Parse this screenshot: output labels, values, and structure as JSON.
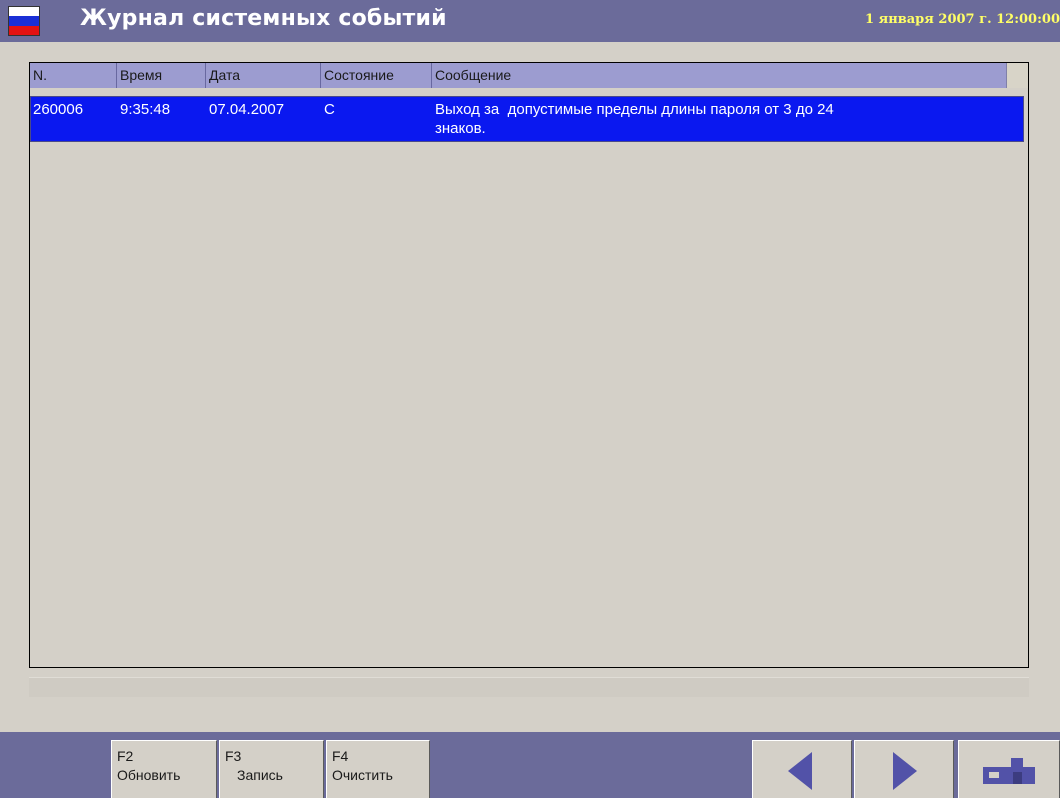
{
  "window": {
    "title": "Журнал системных событий",
    "datetime": "1 января 2007 г. 12:00:00"
  },
  "table": {
    "columns": [
      "N.",
      "Время",
      "Дата",
      "Состояние",
      "Сообщение"
    ],
    "rows": [
      {
        "n": "260006",
        "time": "9:35:48",
        "date": "07.04.2007",
        "state": "C",
        "message_line1": "Выход за  допустимые пределы длины пароля от 3 до 24",
        "message_line2": "знаков."
      }
    ]
  },
  "function_keys": [
    {
      "key": "F2",
      "label": "Обновить"
    },
    {
      "key": "F3",
      "label": "Запись"
    },
    {
      "key": "F4",
      "label": "Очистить"
    }
  ],
  "icons": {
    "flag": "russian-flag-icon",
    "prev": "arrow-left-icon",
    "next": "arrow-right-icon",
    "home": "home-icon"
  },
  "colors": {
    "titlebar": "#6b6b9a",
    "header_row": "#9c9cd0",
    "selected_row": "#0a18f0",
    "datetime_text": "#ffff66",
    "arrow": "#5252a8"
  }
}
